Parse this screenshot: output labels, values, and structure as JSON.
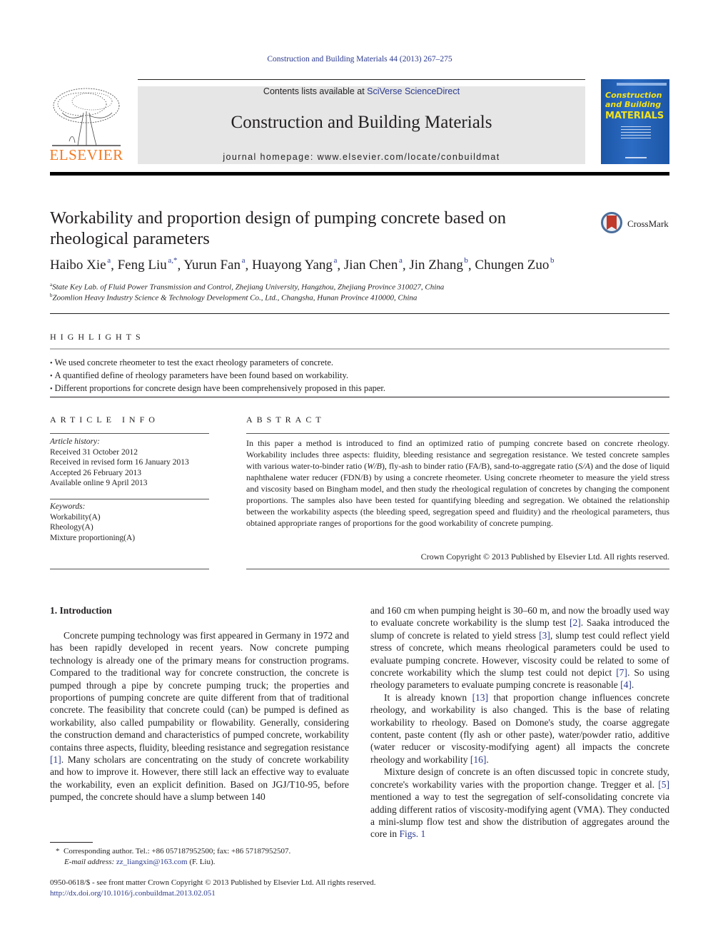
{
  "header": {
    "citation": "Construction and Building Materials 44 (2013) 267–275",
    "contents_prefix": "Contents lists available at ",
    "contents_link": "SciVerse ScienceDirect",
    "journal_title": "Construction and Building Materials",
    "homepage_prefix": "journal homepage: ",
    "homepage_url": "www.elsevier.com/locate/conbuildmat",
    "publisher_logo": "ELSEVIER",
    "cover": {
      "line1": "Construction",
      "line2": "and Building",
      "line3": "MATERIALS"
    }
  },
  "article": {
    "title": "Workability and proportion design of pumping concrete based on rheological parameters",
    "crossmark_label": "CrossMark",
    "authors": [
      {
        "name": "Haibo Xie",
        "sup": "a"
      },
      {
        "name": "Feng Liu",
        "sup": "a,*"
      },
      {
        "name": "Yurun Fan",
        "sup": "a"
      },
      {
        "name": "Huayong Yang",
        "sup": "a"
      },
      {
        "name": "Jian Chen",
        "sup": "a"
      },
      {
        "name": "Jin Zhang",
        "sup": "b"
      },
      {
        "name": "Chungen Zuo",
        "sup": "b"
      }
    ],
    "affiliations": [
      {
        "key": "a",
        "text": "State Key Lab. of Fluid Power Transmission and Control, Zhejiang University, Hangzhou, Zhejiang Province 310027, China"
      },
      {
        "key": "b",
        "text": "Zoomlion Heavy Industry Science & Technology Development Co., Ltd., Changsha, Hunan Province 410000, China"
      }
    ]
  },
  "highlights": {
    "label": "HIGHLIGHTS",
    "items": [
      "We used concrete rheometer to test the exact rheology parameters of concrete.",
      "A quantified define of rheology parameters have been found based on workability.",
      "Different proportions for concrete design have been comprehensively proposed in this paper."
    ]
  },
  "article_info": {
    "label": "ARTICLE INFO",
    "history_heading": "Article history:",
    "history": [
      "Received 31 October 2012",
      "Received in revised form 16 January 2013",
      "Accepted 26 February 2013",
      "Available online 9 April 2013"
    ],
    "keywords_heading": "Keywords:",
    "keywords": [
      "Workability(A)",
      "Rheology(A)",
      "Mixture proportioning(A)"
    ]
  },
  "abstract": {
    "label": "ABSTRACT",
    "text_1": "In this paper a method is introduced to find an optimized ratio of pumping concrete based on concrete rheology. Workability includes three aspects: fluidity, bleeding resistance and segregation resistance. We tested concrete samples with various water-to-binder ratio (",
    "wb": "W/B",
    "text_2": "), fly-ash to binder ratio (FA/B), sand-to-aggregate ratio (",
    "sa": "S/A",
    "text_3": ") and the dose of liquid naphthalene water reducer (FDN/B) by using a concrete rheometer. Using concrete rheometer to measure the yield stress and viscosity based on Bingham model, and then study the rheological regulation of concretes by changing the component proportions. The samples also have been tested for quantifying bleeding and segregation. We obtained the relationship between the workability aspects (the bleeding speed, segregation speed and fluidity) and the rheological parameters, thus obtained appropriate ranges of proportions for the good workability of concrete pumping.",
    "copyright": "Crown Copyright © 2013 Published by Elsevier Ltd. All rights reserved."
  },
  "body": {
    "section_heading": "1. Introduction",
    "left": {
      "p1_a": "Concrete pumping technology was first appeared in Germany in 1972 and has been rapidly developed in recent years. Now concrete pumping technology is already one of the primary means for construction programs. Compared to the traditional way for concrete construction, the concrete is pumped through a pipe by concrete pumping truck; the properties and proportions of pumping concrete are quite different from that of traditional concrete. The feasibility that concrete could (can) be pumped is defined as workability, also called pumpability or flowability. Generally, considering the construction demand and characteristics of pumped concrete, workability contains three aspects, fluidity, bleeding resistance and segregation resistance ",
      "ref1": "[1]",
      "p1_b": ". Many scholars are concentrating on the study of concrete workability and how to improve it. However, there still lack an effective way to evaluate the workability, even an explicit definition. Based on JGJ/T10-95, before pumped, the concrete should have a slump between 140"
    },
    "right": {
      "p1_a": "and 160 cm when pumping height is 30–60 m, and now the broadly used way to evaluate concrete workability is the slump test ",
      "ref2": "[2]",
      "p1_b": ". Saaka introduced the slump of concrete is related to yield stress ",
      "ref3": "[3]",
      "p1_c": ", slump test could reflect yield stress of concrete, which means rheological parameters could be used to evaluate pumping concrete. However, viscosity could be related to some of concrete workability which the slump test could not depict ",
      "ref7": "[7]",
      "p1_d": ". So using rheology parameters to evaluate pumping concrete is reasonable ",
      "ref4": "[4]",
      "p1_e": ".",
      "p2_a": "It is already known ",
      "ref13": "[13]",
      "p2_b": " that proportion change influences concrete rheology, and workability is also changed. This is the base of relating workability to rheology. Based on Domone's study, the coarse aggregate content, paste content (fly ash or other paste), water/powder ratio, additive (water reducer or viscosity-modifying agent) all impacts the concrete rheology and workability ",
      "ref16": "[16]",
      "p2_c": ".",
      "p3_a": "Mixture design of concrete is an often discussed topic in concrete study, concrete's workability varies with the proportion change. Tregger et al. ",
      "ref5": "[5]",
      "p3_b": " mentioned a way to test the segregation of self-consolidating concrete via adding different ratios of viscosity-modifying agent (VMA). They conducted a mini-slump flow test and show the distribution of aggregates around the core in ",
      "figs": "Figs. 1"
    }
  },
  "footnotes": {
    "marker": "*",
    "corresponding": "Corresponding author. Tel.: +86 057187952500; fax: +86 57187952507.",
    "email_label": "E-mail address:",
    "email": "zz_liangxin@163.com",
    "email_suffix": "(F. Liu).",
    "issn_line": "0950-0618/$ - see front matter Crown Copyright © 2013 Published by Elsevier Ltd. All rights reserved.",
    "doi": "http://dx.doi.org/10.1016/j.conbuildmat.2013.02.051"
  },
  "colors": {
    "link": "#2b3a8f",
    "elsevier_orange": "#f47920",
    "banner_gray": "#e6e6e6",
    "cover_blue": "#1c56a6",
    "cover_yellow": "#f3e21c"
  }
}
